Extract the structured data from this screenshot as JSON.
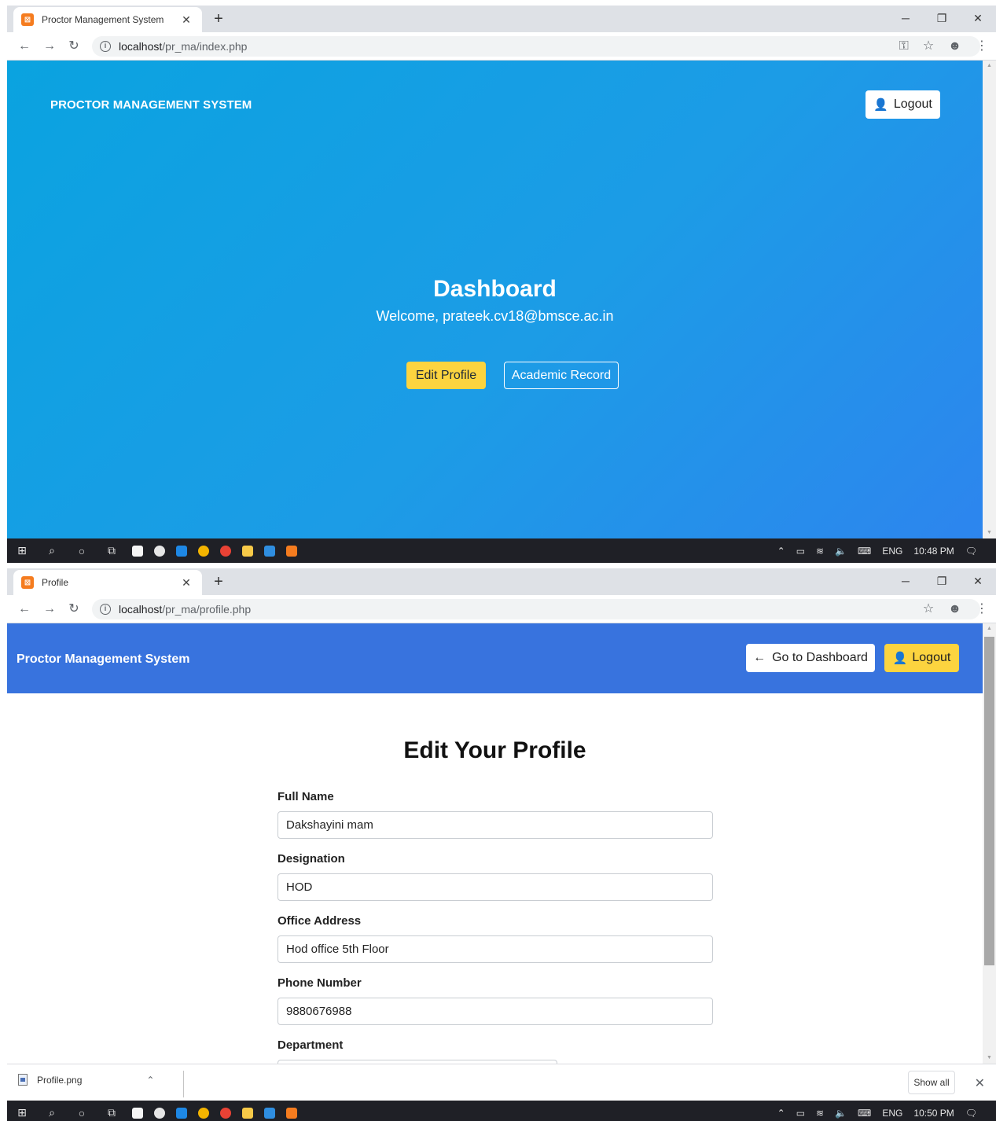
{
  "screen1": {
    "tab": {
      "title": "Proctor Management System",
      "favicon": "xampp-icon"
    },
    "url": {
      "host": "localhost",
      "path": "/pr_ma/index.php"
    },
    "navbar": {
      "brand": "PROCTOR MANAGEMENT SYSTEM",
      "logout_label": "Logout"
    },
    "hero": {
      "title": "Dashboard",
      "welcome": "Welcome, prateek.cv18@bmsce.ac.in",
      "edit_profile_label": "Edit Profile",
      "academic_record_label": "Academic Record"
    },
    "taskbar": {
      "language": "ENG",
      "time": "10:48 PM"
    }
  },
  "screen2": {
    "tab": {
      "title": "Profile",
      "favicon": "xampp-icon"
    },
    "url": {
      "host": "localhost",
      "path": "/pr_ma/profile.php"
    },
    "navbar": {
      "brand": "Proctor Management System",
      "go_to_dashboard_label": "Go to Dashboard",
      "logout_label": "Logout"
    },
    "form": {
      "title": "Edit Your Profile",
      "fields": [
        {
          "label": "Full Name",
          "value": "Dakshayini mam"
        },
        {
          "label": "Designation",
          "value": "HOD"
        },
        {
          "label": "Office Address",
          "value": "Hod office 5th Floor"
        },
        {
          "label": "Phone Number",
          "value": "9880676988"
        },
        {
          "label": "Department",
          "value": ""
        }
      ]
    },
    "downloads": {
      "file_name": "Profile.png",
      "show_all_label": "Show all"
    },
    "taskbar": {
      "language": "ENG",
      "time": "10:50 PM"
    }
  },
  "colors": {
    "dashboard_gradient_start": "#0aa3e0",
    "dashboard_gradient_end": "#2d85ee",
    "profile_navbar": "#3873de",
    "warning_yellow": "#fcd43f"
  }
}
